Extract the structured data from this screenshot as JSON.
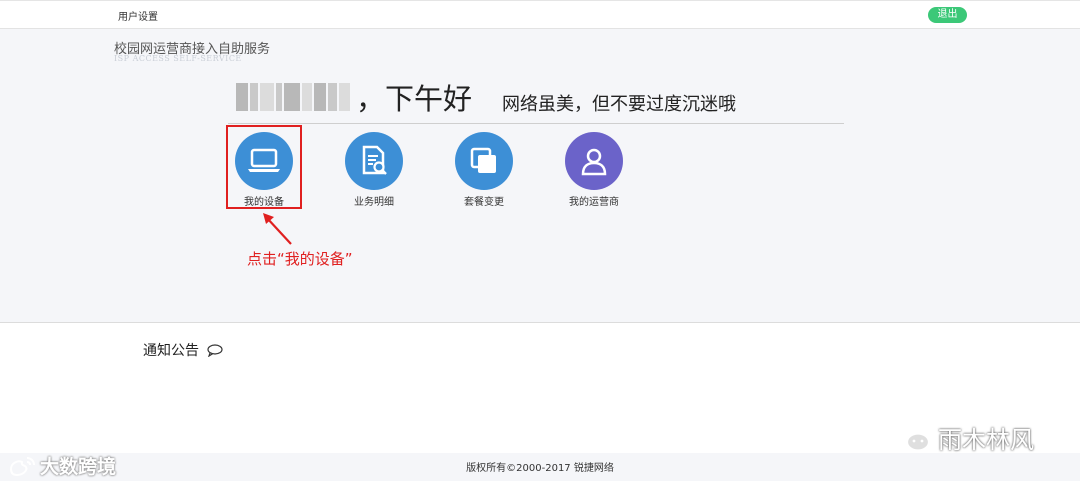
{
  "topbar": {
    "title": "用户设置",
    "logout_label": "退出"
  },
  "service": {
    "title": "校园网运营商接入自助服务",
    "subtitle": "ISP ACCESS SELF-SERVICE"
  },
  "greeting": {
    "text": "，下午好",
    "motto": "网络虽美，但不要过度沉迷哦"
  },
  "menu": [
    {
      "label": "我的设备",
      "icon": "laptop-icon",
      "color": "#3d8fd6"
    },
    {
      "label": "业务明细",
      "icon": "document-search-icon",
      "color": "#3d8fd6"
    },
    {
      "label": "套餐变更",
      "icon": "copy-square-icon",
      "color": "#3d8fd6"
    },
    {
      "label": "我的运营商",
      "icon": "user-icon",
      "color": "#6b63c9"
    }
  ],
  "annotation": {
    "hint": "点击“我的设备”",
    "color": "#e02020"
  },
  "notice": {
    "title": "通知公告"
  },
  "footer": {
    "copyright": "版权所有©2000-2017 锐捷网络"
  },
  "watermarks": {
    "left": "大数跨境",
    "right": "雨木林风"
  },
  "colors": {
    "accent_green": "#3cc878",
    "panel_bg": "#f5f6f9"
  }
}
